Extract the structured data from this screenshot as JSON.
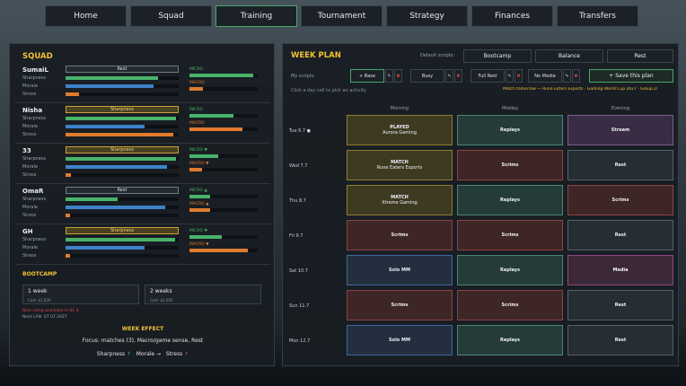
{
  "nav": [
    "Home",
    "Squad",
    "Training",
    "Tournament",
    "Strategy",
    "Finances",
    "Transfers"
  ],
  "squad": {
    "title": "SQUAD",
    "stat_labels": [
      "Sharpness",
      "Morale",
      "Stress"
    ],
    "micro_label": "MICRO",
    "macro_label": "MACRO",
    "players": [
      {
        "name": "SumaiL",
        "activity": "Rest",
        "sharp": 0.82,
        "morale": 0.78,
        "stress": 0.12,
        "micro": 0.93,
        "macro": 0.2,
        "micro_suffix": "",
        "macro_suffix": ""
      },
      {
        "name": "Nisha",
        "activity": "Sharpness",
        "sharp": 0.98,
        "morale": 0.7,
        "stress": 0.95,
        "micro": 0.65,
        "macro": 0.78,
        "micro_suffix": "",
        "macro_suffix": ""
      },
      {
        "name": "33",
        "activity": "Sharpness",
        "sharp": 0.98,
        "morale": 0.9,
        "stress": 0.05,
        "micro": 0.42,
        "macro": 0.18,
        "micro_suffix": "▼",
        "macro_suffix": "▼"
      },
      {
        "name": "OmaR",
        "activity": "Rest",
        "sharp": 0.46,
        "morale": 0.88,
        "stress": 0.04,
        "micro": 0.3,
        "macro": 0.3,
        "micro_suffix": "▲",
        "macro_suffix": "▲"
      },
      {
        "name": "GH",
        "activity": "Sharpness",
        "sharp": 0.97,
        "morale": 0.7,
        "stress": 0.04,
        "micro": 0.48,
        "macro": 0.86,
        "micro_suffix": "▼",
        "macro_suffix": "▼"
      }
    ]
  },
  "bootcamp": {
    "title": "BOOTCAMP",
    "options": [
      {
        "label": "1 week",
        "cost": "Cost: $1,500"
      },
      {
        "label": "2 weeks",
        "cost": "Cost: $2,500"
      }
    ],
    "note_red": "New camp available in 81 d",
    "note_lan": "Next LAN: 07.07.2027"
  },
  "week_effect": {
    "title": "WEEK EFFECT",
    "focus": "Focus: matches (3), Macro/game sense, Rest",
    "sharpness": "Sharpness",
    "morale": "Morale",
    "stress": "Stress",
    "sharp_arrow": "↑",
    "morale_arrow": "→",
    "stress_arrow": "↑"
  },
  "week": {
    "title": "WEEK PLAN",
    "default_scripts_label": "Default scripts:",
    "default_scripts": [
      "Bootcamp",
      "Balance",
      "Rest"
    ],
    "my_scripts_label": "My scripts:",
    "my_scripts": [
      "+ Base",
      "Busy",
      "Full Rest",
      "No Media"
    ],
    "edit_glyph": "✎",
    "delete_glyph": "✖",
    "save_label": "+ Save this plan",
    "hint": "Click a day cell to pick an activity",
    "match_notice": "Match tomorrow — Rune Eaters Esports · Gaming World Cup 2027 · Group D",
    "columns": [
      "Morning",
      "Midday",
      "Evening"
    ],
    "days": [
      {
        "label": "Tue 6.7 ●",
        "cells": [
          {
            "t": "PLAYED",
            "s": "Aurora Gaming",
            "c": "yellow"
          },
          {
            "t": "Replays",
            "s": "",
            "c": "teal"
          },
          {
            "t": "Stream",
            "s": "",
            "c": "purple"
          }
        ]
      },
      {
        "label": "Wed 7.7",
        "cells": [
          {
            "t": "MATCH",
            "s": "Rune Eaters Esports",
            "c": "yellow"
          },
          {
            "t": "Scrims",
            "s": "",
            "c": "red"
          },
          {
            "t": "Rest",
            "s": "",
            "c": "gray"
          }
        ]
      },
      {
        "label": "Thu 8.7",
        "cells": [
          {
            "t": "MATCH",
            "s": "Xtreme Gaming",
            "c": "yellow"
          },
          {
            "t": "Replays",
            "s": "",
            "c": "teal"
          },
          {
            "t": "Scrims",
            "s": "",
            "c": "red"
          }
        ]
      },
      {
        "label": "Fri 9.7",
        "cells": [
          {
            "t": "Scrims",
            "s": "",
            "c": "red"
          },
          {
            "t": "Scrims",
            "s": "",
            "c": "red"
          },
          {
            "t": "Rest",
            "s": "",
            "c": "gray"
          }
        ]
      },
      {
        "label": "Sat 10.7",
        "cells": [
          {
            "t": "Solo MM",
            "s": "",
            "c": "blue"
          },
          {
            "t": "Replays",
            "s": "",
            "c": "teal"
          },
          {
            "t": "Media",
            "s": "",
            "c": "magenta"
          }
        ]
      },
      {
        "label": "Sun 11.7",
        "cells": [
          {
            "t": "Scrims",
            "s": "",
            "c": "red"
          },
          {
            "t": "Scrims",
            "s": "",
            "c": "red"
          },
          {
            "t": "Rest",
            "s": "",
            "c": "gray"
          }
        ]
      },
      {
        "label": "Mon 12.7",
        "cells": [
          {
            "t": "Solo MM",
            "s": "",
            "c": "blue"
          },
          {
            "t": "Replays",
            "s": "",
            "c": "teal"
          },
          {
            "t": "Rest",
            "s": "",
            "c": "gray"
          }
        ]
      }
    ]
  },
  "colors": {
    "accent": "#f2c232",
    "active_border": "#49a66a",
    "red": "#d94848"
  }
}
